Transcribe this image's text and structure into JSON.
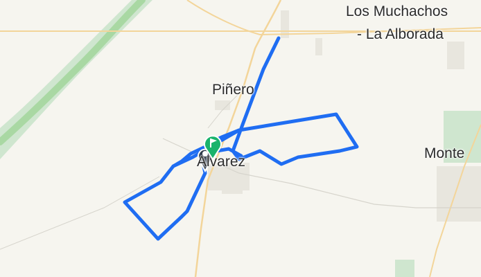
{
  "map": {
    "places": {
      "los_muchachos_line1": "Los Muchachos",
      "los_muchachos_line2": "- La Alborada",
      "pinero": "Piñero",
      "monte": "Monte",
      "alvarez": "Alvarez"
    },
    "markers": {
      "start": "start-marker",
      "end": "finish-flag-marker"
    },
    "colors": {
      "background": "#f6f5ef",
      "route": "#1f6df2",
      "field_green": "#cfe6cf",
      "river": "#a9d8a3",
      "road": "#f3d59a",
      "marker_dark": "#2f3b4a",
      "marker_green": "#19b36b"
    }
  }
}
